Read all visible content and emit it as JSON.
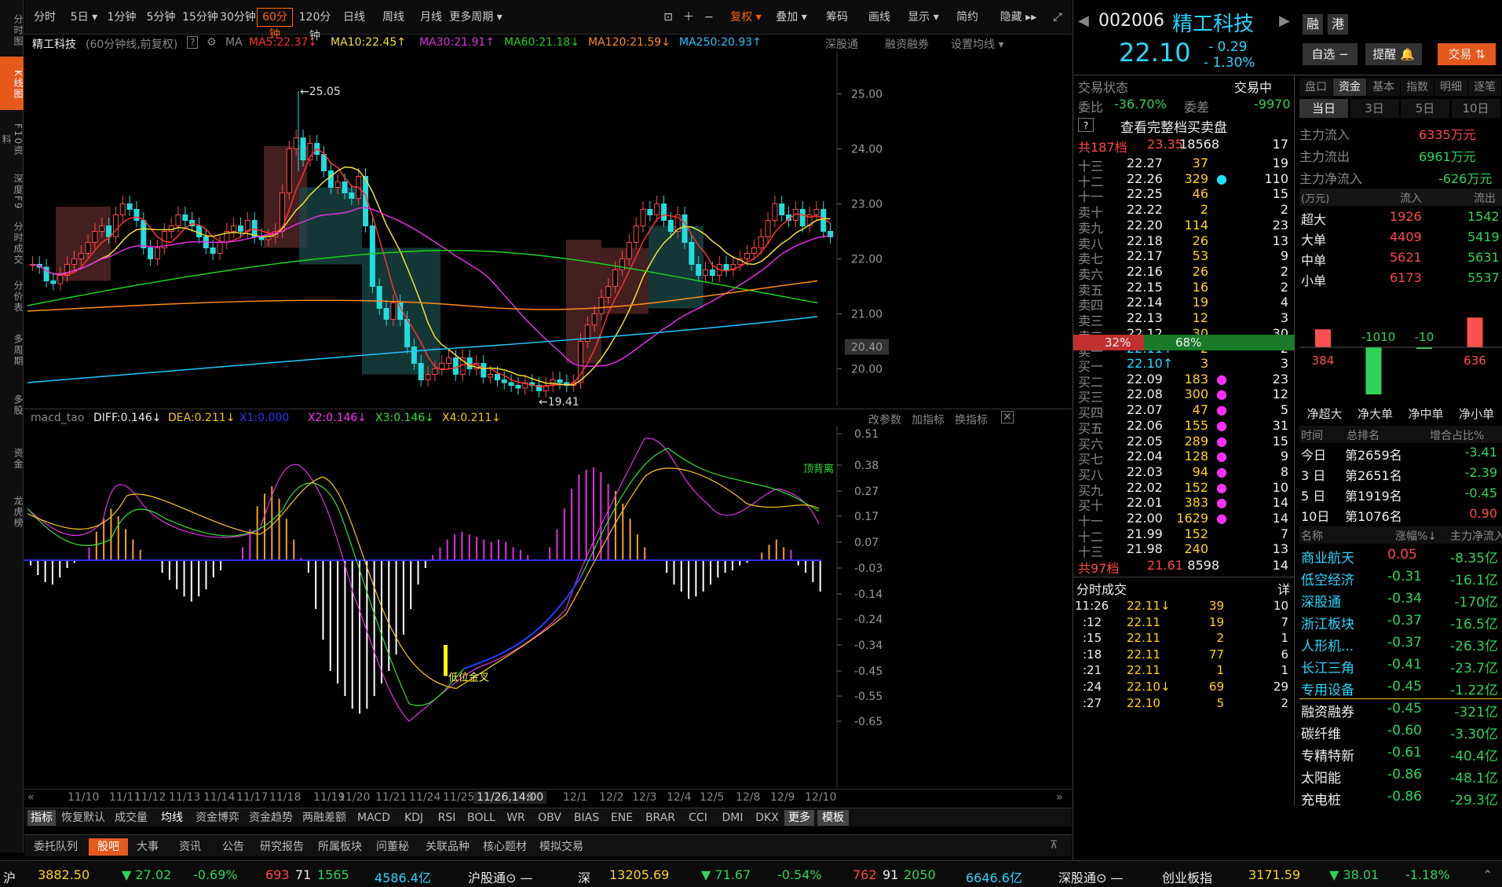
{
  "rail": [
    "分时图",
    "K线图",
    "F10资料",
    "深度F9",
    "分时成交",
    "分价表",
    "多周期",
    "多股",
    "资金",
    "龙虎榜"
  ],
  "toolbar": {
    "periods": [
      "分时",
      "5日 ▾",
      "1分钟",
      "5分钟",
      "15分钟",
      "30分钟",
      "60分钟",
      "120分钟",
      "日线",
      "周线",
      "月线",
      "更多周期 ▾"
    ],
    "tools": [
      "复权 ▾",
      "叠加 ▾",
      "筹码",
      "画线",
      "显示 ▾",
      "简约",
      "隐藏 ▸▸"
    ]
  },
  "info": {
    "name": "精工科技",
    "mode": "(60分钟线,前复权)",
    "help": "?",
    "ma": "MA",
    "ma5": "MA5:22.37↓",
    "ma10": "MA10:22.45↑",
    "ma30": "MA30:21.91↑",
    "ma60": "MA60:21.18↓",
    "ma120": "MA120:21.59↓",
    "ma250": "MA250:20.93↑",
    "links": [
      "深股通",
      "融资融券",
      "设置均线 ▾"
    ]
  },
  "kchart": {
    "high_label": "←25.05",
    "low_label": "←19.41",
    "price_ticks": [
      "25.00",
      "24.00",
      "23.00",
      "22.00",
      "21.00",
      "20.00"
    ],
    "cur_price": "20.40"
  },
  "macd": {
    "name": "macd_tao",
    "diff": "DIFF:0.146↓",
    "dea": "DEA:0.211↓",
    "x1": "X1:0.000",
    "x2": "X2:0.146↓",
    "x3": "X3:0.146↓",
    "x4": "X4:0.211↓",
    "links": [
      "改参数",
      "加指标",
      "换指标"
    ],
    "ticks": [
      "0.51",
      "0.38",
      "0.27",
      "0.17",
      "0.07",
      "-0.03",
      "-0.14",
      "-0.24",
      "-0.34",
      "-0.45",
      "-0.55",
      "-0.65"
    ],
    "ann_top": "顶背离",
    "ann_low": "低位金叉"
  },
  "dates": [
    "11/10",
    "11/11",
    "11/12",
    "11/13",
    "11/14",
    "11/17",
    "11/18",
    "11/19",
    "11/20",
    "11/21",
    "11/24",
    "11/25",
    "11/26,14:00",
    "8",
    "12/1",
    "12/2",
    "12/3",
    "12/4",
    "12/5",
    "12/8",
    "12/9",
    "12/10"
  ],
  "bottom_tabs": [
    "指标",
    "恢复默认",
    "成交量",
    "均线",
    "资金博弈",
    "资金趋势",
    "两融差额",
    "MACD",
    "KDJ",
    "RSI",
    "BOLL",
    "WR",
    "OBV",
    "BIAS",
    "ENE",
    "BRAR",
    "CCI",
    "DMI",
    "DKX",
    "更多",
    "模板"
  ],
  "bottom_tabs2": [
    "委托队列",
    "股吧",
    "大事",
    "资讯",
    "公告",
    "研究报告",
    "所属板块",
    "问董秘",
    "关联品种",
    "核心题材",
    "模拟交易"
  ],
  "status": {
    "sh": "沪",
    "sh_idx": "3882.50",
    "sh_chg": "▼ 27.02",
    "sh_pct": "-0.69%",
    "sh_up": "693",
    "sh_flat": "71",
    "sh_dn": "1565",
    "sh_amt": "4586.4亿",
    "hgt": "沪股通⊙ —",
    "sz": "深",
    "sz_idx": "13205.69",
    "sz_chg": "▼ 71.67",
    "sz_pct": "-0.54%",
    "sz_up": "762",
    "sz_flat": "91",
    "sz_dn": "2050",
    "sz_amt": "6646.6亿",
    "sgt": "深股通⊙ —",
    "cyb": "创业板指",
    "cyb_idx": "3171.59",
    "cyb_chg": "▼ 38.01",
    "cyb_pct": "-1.18%"
  },
  "quote": {
    "code": "002006",
    "name": "精工科技",
    "price": "22.10",
    "chg": "- 0.29",
    "pct": "- 1.30%",
    "tags": [
      "融",
      "港"
    ],
    "btn_watch": "自选 −",
    "btn_alert": "提醒 🔔",
    "btn_trade": "交易 ⇅"
  },
  "ob": {
    "status_lbl": "交易状态",
    "status": "交易中",
    "wb_lbl": "委比",
    "wb": "-36.70%",
    "wc_lbl": "委差",
    "wc": "-9970",
    "full": "查看完整档买卖盘",
    "total_sell_lbl": "共187档",
    "total_sell_price": "23.35",
    "total_sell_vol": "18568",
    "total_sell_cnt": "17",
    "asks": [
      [
        "十三",
        "22.27",
        "37",
        "19"
      ],
      [
        "十二",
        "22.26",
        "329",
        "110"
      ],
      [
        "十一",
        "22.25",
        "46",
        "15"
      ],
      [
        "卖十",
        "22.22",
        "2",
        "2"
      ],
      [
        "卖九",
        "22.20",
        "114",
        "23"
      ],
      [
        "卖八",
        "22.18",
        "26",
        "13"
      ],
      [
        "卖七",
        "22.17",
        "53",
        "9"
      ],
      [
        "卖六",
        "22.16",
        "26",
        "2"
      ],
      [
        "卖五",
        "22.15",
        "16",
        "2"
      ],
      [
        "卖四",
        "22.14",
        "19",
        "4"
      ],
      [
        "卖三",
        "22.13",
        "12",
        "3"
      ],
      [
        "卖二",
        "22.12",
        "30",
        "30"
      ],
      [
        "卖一",
        "22.11↑",
        "2",
        "2"
      ]
    ],
    "ratio_sell": "32%",
    "ratio_buy": "68%",
    "bids": [
      [
        "买一",
        "22.10↑",
        "3",
        "3"
      ],
      [
        "买二",
        "22.09",
        "183",
        "23"
      ],
      [
        "买三",
        "22.08",
        "300",
        "12"
      ],
      [
        "买四",
        "22.07",
        "47",
        "5"
      ],
      [
        "买五",
        "22.06",
        "155",
        "31"
      ],
      [
        "买六",
        "22.05",
        "289",
        "15"
      ],
      [
        "买七",
        "22.04",
        "128",
        "9"
      ],
      [
        "买八",
        "22.03",
        "94",
        "8"
      ],
      [
        "买九",
        "22.02",
        "152",
        "10"
      ],
      [
        "买十",
        "22.01",
        "383",
        "14"
      ],
      [
        "十一",
        "22.00",
        "1629",
        "14"
      ],
      [
        "十二",
        "21.99",
        "152",
        "7"
      ],
      [
        "十三",
        "21.98",
        "240",
        "13"
      ]
    ],
    "total_buy_lbl": "共97档",
    "total_buy_price": "21.61",
    "total_buy_vol": "8598",
    "total_buy_cnt": "14"
  },
  "trades": {
    "title": "分时成交",
    "detail": "详",
    "rows": [
      [
        "11:26",
        "22.11↓",
        "39",
        "10"
      ],
      [
        ":12",
        "22.11",
        "19",
        "7"
      ],
      [
        ":15",
        "22.11",
        "2",
        "1"
      ],
      [
        ":18",
        "22.11",
        "77",
        "6"
      ],
      [
        ":21",
        "22.11",
        "1",
        "1"
      ],
      [
        ":24",
        "22.10↓",
        "69",
        "29"
      ],
      [
        ":27",
        "22.10",
        "5",
        "2"
      ]
    ]
  },
  "flow": {
    "tabs": [
      "盘口",
      "资金",
      "基本",
      "指数",
      "明细",
      "逐笔"
    ],
    "period_tabs": [
      "当日",
      "3日",
      "5日",
      "10日"
    ],
    "main_in_lbl": "主力流入",
    "main_in": "6335万元",
    "main_out_lbl": "主力流出",
    "main_out": "6961万元",
    "main_net_lbl": "主力净流入",
    "main_net": "-626万元",
    "unit": "(万元)",
    "in_lbl": "流入",
    "out_lbl": "流出",
    "rows": [
      [
        "超大",
        "1926",
        "1542"
      ],
      [
        "大单",
        "4409",
        "5419"
      ],
      [
        "中单",
        "5621",
        "5631"
      ],
      [
        "小单",
        "6173",
        "5537"
      ]
    ],
    "bars": [
      {
        "label": "净超大",
        "value": 384
      },
      {
        "label": "净大单",
        "value": -1010
      },
      {
        "label": "净中单",
        "value": -10
      },
      {
        "label": "净小单",
        "value": 636
      }
    ],
    "rank_hdr": [
      "时间",
      "总排名",
      "增合占比%"
    ],
    "ranks": [
      [
        "今日",
        "第2659名",
        "-3.41"
      ],
      [
        "3 日",
        "第2651名",
        "-2.39"
      ],
      [
        "5 日",
        "第1919名",
        "-0.45"
      ],
      [
        "10日",
        "第1076名",
        "0.90"
      ]
    ],
    "sec_hdr": [
      "名称",
      "涨幅%↓",
      "主力净流入"
    ],
    "sectors": [
      [
        "商业航天",
        "0.05",
        "-8.35亿"
      ],
      [
        "低空经济",
        "-0.31",
        "-16.1亿"
      ],
      [
        "深股通",
        "-0.34",
        "-170亿"
      ],
      [
        "浙江板块",
        "-0.37",
        "-16.5亿"
      ],
      [
        "人形机...",
        "-0.37",
        "-26.3亿"
      ],
      [
        "长江三角",
        "-0.41",
        "-23.7亿"
      ],
      [
        "专用设备",
        "-0.45",
        "-1.22亿"
      ],
      [
        "融资融券",
        "-0.45",
        "-321亿"
      ],
      [
        "碳纤维",
        "-0.60",
        "-3.30亿"
      ],
      [
        "专精特新",
        "-0.61",
        "-40.4亿"
      ],
      [
        "太阳能",
        "-0.86",
        "-48.1亿"
      ],
      [
        "充电桩",
        "-0.86",
        "-29.3亿"
      ]
    ]
  },
  "colors": {
    "up": "#ff4848",
    "down": "#22dddd",
    "ma5": "#ff3030",
    "ma10": "#f0e030",
    "ma30": "#e030e0",
    "ma60": "#20d020",
    "ma120": "#ff8c1a",
    "ma250": "#20c8ff"
  }
}
